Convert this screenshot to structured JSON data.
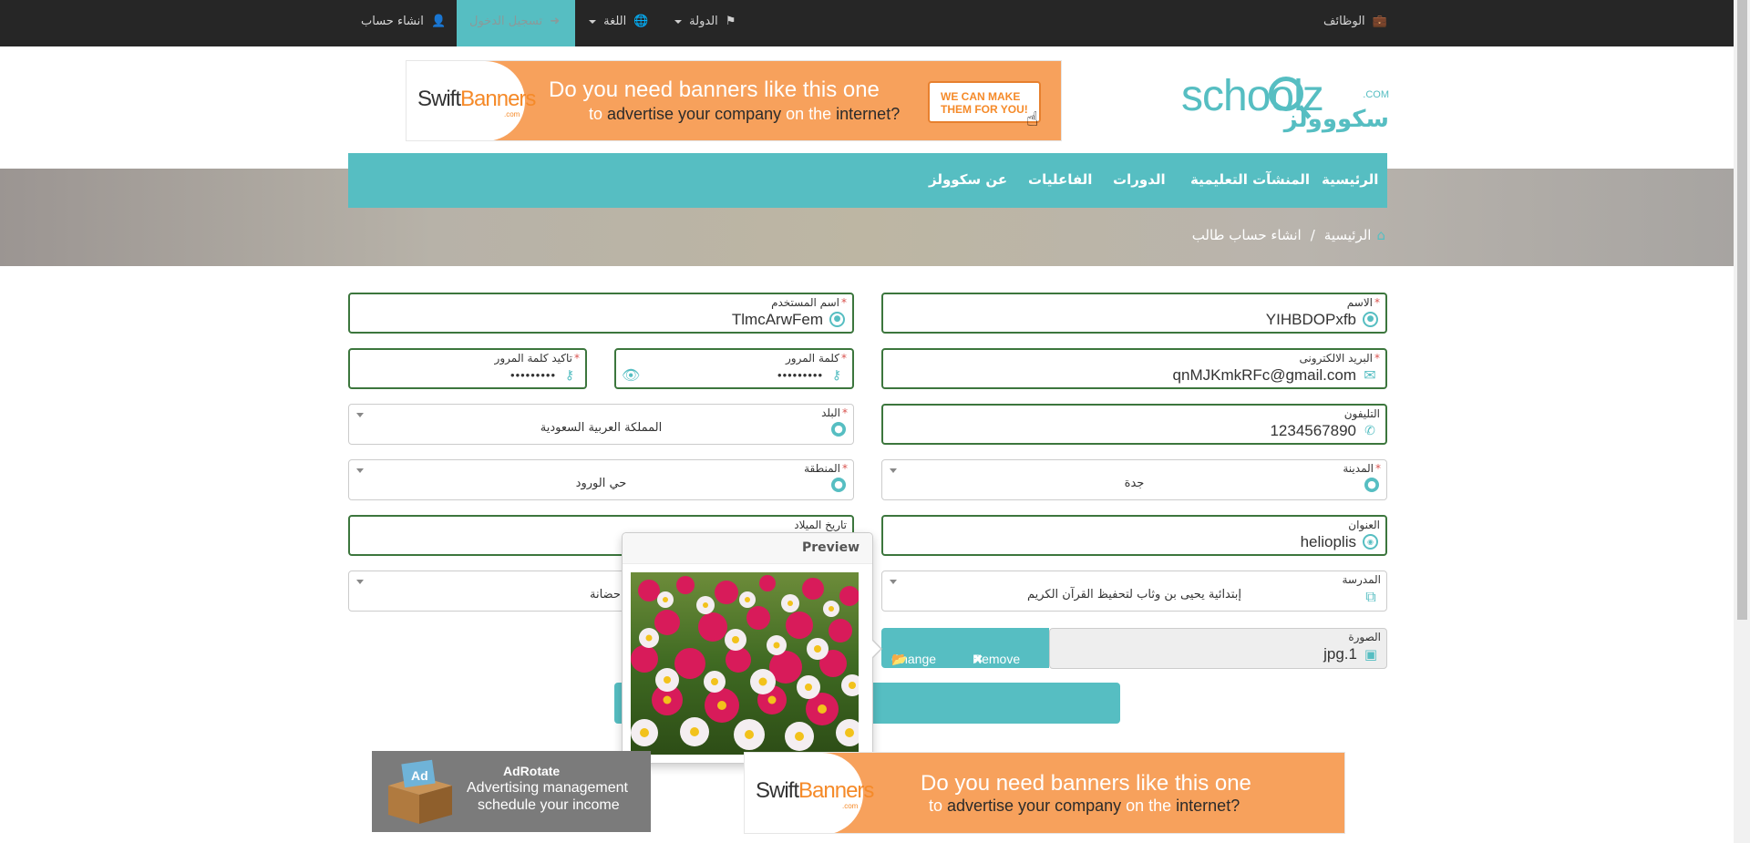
{
  "topbar": {
    "jobs": "الوظائف",
    "country": "الدولة",
    "language": "اللغة",
    "login": "تسجيل الدخول",
    "signup": "انشاء حساب"
  },
  "logo": {
    "en": "schoolz",
    "com": ".COM",
    "ar": "سكووولز"
  },
  "banner": {
    "brand": "Swift",
    "brand2": "Banners",
    "brand_com": ".com",
    "line1": "Do you need banners like this one",
    "line2_a": "to ",
    "line2_b": "advertise your company",
    "line2_c": " on the ",
    "line2_d": "internet?",
    "cta1": "WE CAN MAKE",
    "cta2": "THEM FOR YOU!"
  },
  "nav": {
    "home": "الرئيسية",
    "institutions": "المنشآت التعليمية",
    "courses": "الدورات",
    "events": "الفاعليات",
    "about": "عن سكوولز"
  },
  "breadcrumb": {
    "home": "الرئيسية",
    "sep": "/",
    "current": "انشاء حساب طالب"
  },
  "form": {
    "required_mark": "*",
    "name_label": "الاسم",
    "name_value": "YIHBDOPxfb",
    "username_label": "اسم المستخدم",
    "username_value": "TlmcArwFem",
    "email_label": "البريد الالكترونى",
    "email_value": "qnMJKmkRFc@gmail.com",
    "password_label": "كلمة المرور",
    "password_value": "•••••••••",
    "confirm_label": "تاكيد كلمة المرور",
    "confirm_value": "•••••••••",
    "phone_label": "التليفون",
    "phone_value": "1234567890",
    "country_label": "البلد",
    "country_value": "المملكة العربية السعودية",
    "city_label": "المدينة",
    "city_value": "جدة",
    "region_label": "المنطقة",
    "region_value": "حي الورود",
    "address_label": "العنوان",
    "address_value": "helioplis",
    "birth_label": "تاريخ الميلاد",
    "school_label": "المدرسة",
    "school_value": "إبتدائية يحيى بن وثاب لتحفيظ القرآن الكريم",
    "level_value_partial": "حضانة",
    "photo_label": "الصورة",
    "photo_value": "jpg.1",
    "change_label": "Change",
    "remove_label": "Remove"
  },
  "preview": {
    "title": "Preview"
  },
  "adrotate": {
    "title": "AdRotate",
    "line1": "Advertising management",
    "line2": "schedule your income"
  },
  "colors": {
    "accent": "#56bec2",
    "topbar": "#262626",
    "valid_border": "#3c763d",
    "banner_orange": "#f7a15c"
  }
}
